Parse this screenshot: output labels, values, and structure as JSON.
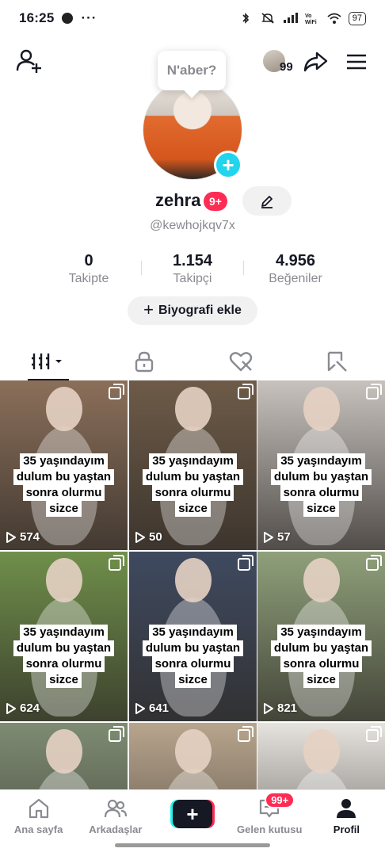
{
  "status_bar": {
    "time": "16:25",
    "more": "···",
    "battery": "97"
  },
  "tooltip": "N'aber?",
  "top_nav": {
    "mini_count": "99"
  },
  "profile": {
    "name": "zehra",
    "badge": "9+",
    "handle": "@kewhojkqv7x",
    "stats": [
      {
        "value": "0",
        "label": "Takipte"
      },
      {
        "value": "1.154",
        "label": "Takipçi"
      },
      {
        "value": "4.956",
        "label": "Beğeniler"
      }
    ],
    "bio_button": "Biyografi ekle"
  },
  "videos": [
    {
      "caption": [
        "35 yaşındayım",
        "dulum bu yaştan",
        "sonra olurmu",
        "sizce"
      ],
      "views": "574",
      "bg": "#8b6f5a"
    },
    {
      "caption": [
        "35 yaşındayım",
        "dulum bu yaştan",
        "sonra olurmu",
        "sizce"
      ],
      "views": "50",
      "bg": "#6e5b48"
    },
    {
      "caption": [
        "35 yaşındayım",
        "dulum bu yaştan",
        "sonra olurmu",
        "sizce"
      ],
      "views": "57",
      "bg": "#c7c2bd"
    },
    {
      "caption": [
        "35 yaşındayım",
        "dulum bu yaştan",
        "sonra olurmu",
        "sizce"
      ],
      "views": "624",
      "bg": "#6f8f4a"
    },
    {
      "caption": [
        "35 yaşındayım",
        "dulum bu yaştan",
        "sonra olurmu",
        "sizce"
      ],
      "views": "641",
      "bg": "#3f4a60"
    },
    {
      "caption": [
        "35 yaşındayım",
        "dulum bu yaştan",
        "sonra olurmu",
        "sizce"
      ],
      "views": "821",
      "bg": "#8fa07a"
    },
    {
      "caption": [],
      "views": "",
      "bg": "#7e8c73"
    },
    {
      "caption": [],
      "views": "",
      "bg": "#b8a58d"
    },
    {
      "caption": [],
      "views": "",
      "bg": "#e6e3df"
    }
  ],
  "bottom_nav": [
    {
      "label": "Ana sayfa",
      "icon": "home-icon"
    },
    {
      "label": "Arkadaşlar",
      "icon": "friends-icon"
    },
    {
      "label": "",
      "icon": "create-icon"
    },
    {
      "label": "Gelen kutusu",
      "icon": "inbox-icon",
      "badge": "99+"
    },
    {
      "label": "Profil",
      "icon": "profile-icon"
    }
  ],
  "colors": {
    "accent": "#fe2c55",
    "cyan": "#25f4ee",
    "text": "#161823",
    "muted": "#8a8b91"
  }
}
